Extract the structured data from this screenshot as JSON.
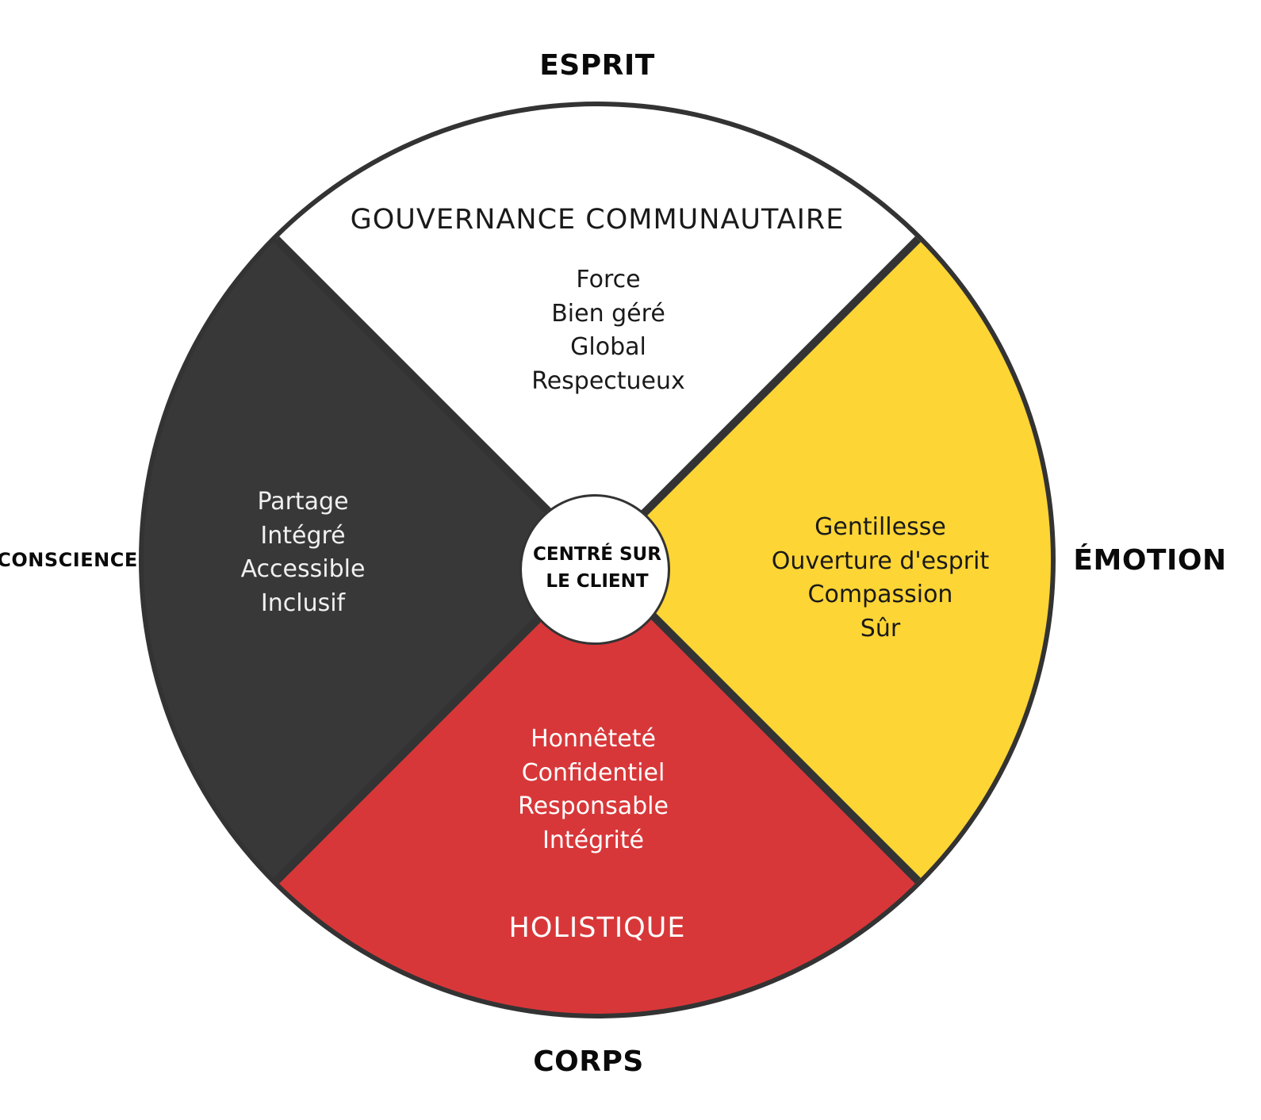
{
  "colors": {
    "spirit": "#ffffff",
    "emotion": "#fdd535",
    "body": "#d83739",
    "awareness": "#383838",
    "outline": "#333333",
    "center": "#ffffff"
  },
  "directions": {
    "top": "ESPRIT",
    "right": "ÉMOTION",
    "bottom": "CORPS",
    "left": "CONSCIENCE"
  },
  "center": {
    "line1": "CENTRÉ SUR",
    "line2": "LE CLIENT"
  },
  "quadrants": {
    "top": {
      "heading": "GOUVERNANCE COMMUNAUTAIRE",
      "words": [
        "Force",
        "Bien géré",
        "Global",
        "Respectueux"
      ]
    },
    "left": {
      "words": [
        "Partage",
        "Intégré",
        "Accessible",
        "Inclusif"
      ]
    },
    "right": {
      "words": [
        "Gentillesse",
        "Ouverture d'esprit",
        "Compassion",
        "Sûr"
      ]
    },
    "bottom": {
      "heading": "HOLISTIQUE",
      "words": [
        "Honnêteté",
        "Confidentiel",
        "Responsable",
        "Intégrité"
      ]
    }
  }
}
